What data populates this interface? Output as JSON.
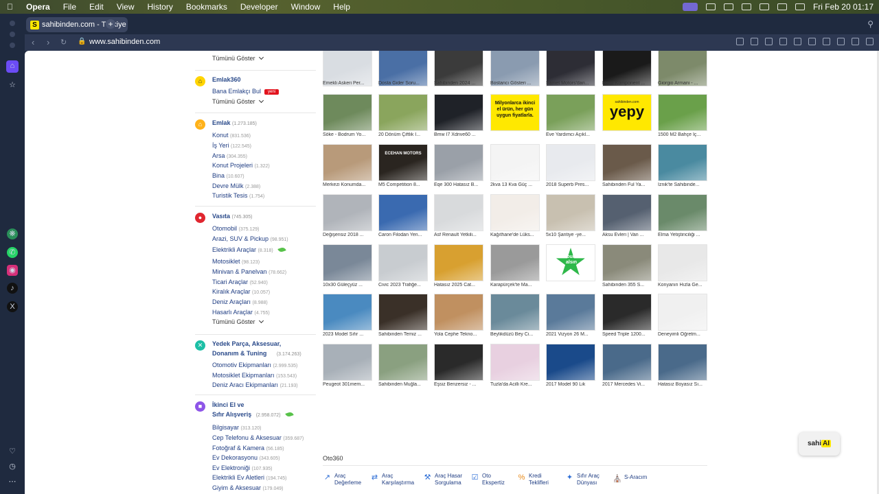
{
  "menubar": {
    "app": "Opera",
    "items": [
      "File",
      "Edit",
      "View",
      "History",
      "Bookmarks",
      "Developer",
      "Window",
      "Help"
    ],
    "clock": "Fri Feb 20  01:17"
  },
  "browser": {
    "tab_title": "sahibinden.com - Türkiye",
    "url": "www.sahibinden.com"
  },
  "sidebar": {
    "top_show_all": "Tümünü Göster",
    "emlak360": {
      "title": "Emlak360",
      "item": "Bana Emlakçı Bul",
      "badge": "yeni",
      "show_all": "Tümünü Göster"
    },
    "emlak": {
      "title": "Emlak",
      "count": "(1.273.185)",
      "items": [
        {
          "label": "Konut",
          "count": "(831.536)"
        },
        {
          "label": "İş Yeri",
          "count": "(122.545)"
        },
        {
          "label": "Arsa",
          "count": "(304.355)"
        },
        {
          "label": "Konut Projeleri",
          "count": "(1.322)"
        },
        {
          "label": "Bina",
          "count": "(10.607)"
        },
        {
          "label": "Devre Mülk",
          "count": "(2.388)"
        },
        {
          "label": "Turistik Tesis",
          "count": "(1.754)"
        }
      ]
    },
    "vasita": {
      "title": "Vasıta",
      "count": "(745.305)",
      "items": [
        {
          "label": "Otomobil",
          "count": "(375.129)"
        },
        {
          "label": "Arazi, SUV & Pickup",
          "count": "(98.951)"
        },
        {
          "label": "Elektrikli Araçlar",
          "count": "(8.318)"
        },
        {
          "label": "Motosiklet",
          "count": "(98.123)"
        },
        {
          "label": "Minivan & Panelvan",
          "count": "(78.662)"
        },
        {
          "label": "Ticari Araçlar",
          "count": "(52.940)"
        },
        {
          "label": "Kiralık Araçlar",
          "count": "(10.057)"
        },
        {
          "label": "Deniz Araçları",
          "count": "(8.988)"
        },
        {
          "label": "Hasarlı Araçlar",
          "count": "(4.755)"
        }
      ],
      "show_all": "Tümünü Göster"
    },
    "yedek": {
      "title_1": "Yedek Parça, Aksesuar,",
      "title_2": "Donanım & Tuning",
      "count": "(3.174.263)",
      "items": [
        {
          "label": "Otomotiv Ekipmanları",
          "count": "(2.999.535)"
        },
        {
          "label": "Motosiklet Ekipmanları",
          "count": "(153.543)"
        },
        {
          "label": "Deniz Aracı Ekipmanları",
          "count": "(21.193)"
        }
      ]
    },
    "ikinci": {
      "title_1": "İkinci El ve",
      "title_2": "Sıfır Alışveriş",
      "count": "(2.958.072)",
      "items": [
        {
          "label": "Bilgisayar",
          "count": "(313.120)"
        },
        {
          "label": "Cep Telefonu & Aksesuar",
          "count": "(359.687)"
        },
        {
          "label": "Fotoğraf & Kamera",
          "count": "(56.185)"
        },
        {
          "label": "Ev Dekorasyonu",
          "count": "(343.605)"
        },
        {
          "label": "Ev Elektroniği",
          "count": "(107.935)"
        },
        {
          "label": "Elektrikli Ev Aletleri",
          "count": "(194.745)"
        },
        {
          "label": "Giyim & Aksesuar",
          "count": "(179.049)"
        }
      ]
    }
  },
  "showcase": {
    "captions": [
      [
        "Emekli Askeri Per...",
        "Dosta Gider Soru...",
        "Sahibinden 2024 ...",
        "Bostancı Gösteri ...",
        "Samet Motors'dan...",
        "Hertz Komponent ...",
        "Giorgio Armani - ..."
      ],
      [
        "Söke - Bodrum Yo...",
        "20 Dönüm Çiftlik I...",
        "Bmw I7 Xdrive60 ...",
        "",
        "Eve Yardımcı Açıkl...",
        "",
        "1500 M2 Bahçe İç..."
      ],
      [
        "Merkezi Konumda...",
        "M5 Competition 8...",
        "Eqe 300 Hatasız B...",
        "2kva 13 Kva Güç ...",
        "2018 Superb Pres...",
        "Sahibinden Ful Ya...",
        "İznik'te Sahibinde..."
      ],
      [
        "Değişensiz 2018 ...",
        "Caron Filodan Yen...",
        "Asf Renault Yetkili...",
        "Kağıthane'de Lüks...",
        "5x10 Şantiye -ye...",
        "Aksu Evleri | Van ...",
        "Elma Yetiştiriciliği ..."
      ],
      [
        "10x30 Güleçyüz ...",
        "Civic 2023 Trafiğe...",
        "Hatasız 2025 Cat...",
        "Karapürçek'te Ma...",
        "",
        "Sahibinden 355 S...",
        "Konyanın Hızla Ge..."
      ],
      [
        "2023 Model Sıfır ...",
        "Sahibinden Temiz ...",
        "Yola Cephe Tekno...",
        "Beylikdüzü Bey Ci...",
        "2021 Vizyon 26 M...",
        "Speed Triple 1200...",
        "Deneyimli Öğretm..."
      ],
      [
        "Peugeot 301mem...",
        "Sahibinden Muğla...",
        "Eşsiz Benzersiz - ...",
        "Tuzla'da Acilli Kre...",
        "2017 Model 90 Lik",
        "2017 Mercedes Vi...",
        "Hatasız Boyasız Sı..."
      ]
    ],
    "ad_milyon": "Milyonlarca ikinci el ürün, her gün uygun fiyatlarla.",
    "ad_yepy_small": "sahibinden.com",
    "ad_yepy": "yepy",
    "ad_ilan": "İlanım burada yer alsın",
    "ad_ecehan": "ECEHAN MOTORS"
  },
  "oto360": {
    "title": "Oto360",
    "items": [
      {
        "label": "Araç\nDeğerleme"
      },
      {
        "label": "Araç\nKarşılaştırma"
      },
      {
        "label": "Araç Hasar\nSorgulama"
      },
      {
        "label": "Oto\nEkspertiz"
      },
      {
        "label": "Kredi\nTeklifleri"
      },
      {
        "label": "Sıfır Araç\nDünyası"
      },
      {
        "label": "S-Aracım"
      }
    ]
  },
  "assistant": {
    "label_prefix": "sahi",
    "label_ai": "AI"
  },
  "colors": {
    "brand_yellow": "#ffe800",
    "link_blue": "#1e3c82",
    "badge_red": "#e2141e"
  }
}
